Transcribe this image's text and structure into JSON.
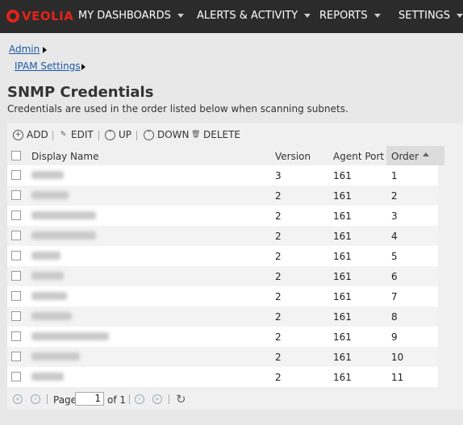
{
  "nav": {
    "logo": "VEOLIA",
    "items": [
      "MY DASHBOARDS",
      "ALERTS & ACTIVITY",
      "REPORTS",
      "SETTINGS"
    ]
  },
  "breadcrumb": {
    "level1": "Admin",
    "level2": "IPAM Settings"
  },
  "page": {
    "title": "SNMP Credentials",
    "subtitle": "Credentials are used in the order listed below when scanning subnets."
  },
  "toolbar": {
    "add": "ADD",
    "edit": "EDIT",
    "up": "UP",
    "down": "DOWN",
    "delete": "DELETE"
  },
  "table": {
    "columns": {
      "name": "Display Name",
      "version": "Version",
      "port": "Agent Port",
      "order": "Order"
    },
    "rows": [
      {
        "version": "3",
        "port": "161",
        "order": "1"
      },
      {
        "version": "2",
        "port": "161",
        "order": "2"
      },
      {
        "version": "2",
        "port": "161",
        "order": "3"
      },
      {
        "version": "2",
        "port": "161",
        "order": "4"
      },
      {
        "version": "2",
        "port": "161",
        "order": "5"
      },
      {
        "version": "2",
        "port": "161",
        "order": "6"
      },
      {
        "version": "2",
        "port": "161",
        "order": "7"
      },
      {
        "version": "2",
        "port": "161",
        "order": "8"
      },
      {
        "version": "2",
        "port": "161",
        "order": "9"
      },
      {
        "version": "2",
        "port": "161",
        "order": "10"
      },
      {
        "version": "2",
        "port": "161",
        "order": "11"
      }
    ]
  },
  "pager": {
    "page_label": "Page",
    "page_value": "1",
    "of_label": "of 1"
  }
}
